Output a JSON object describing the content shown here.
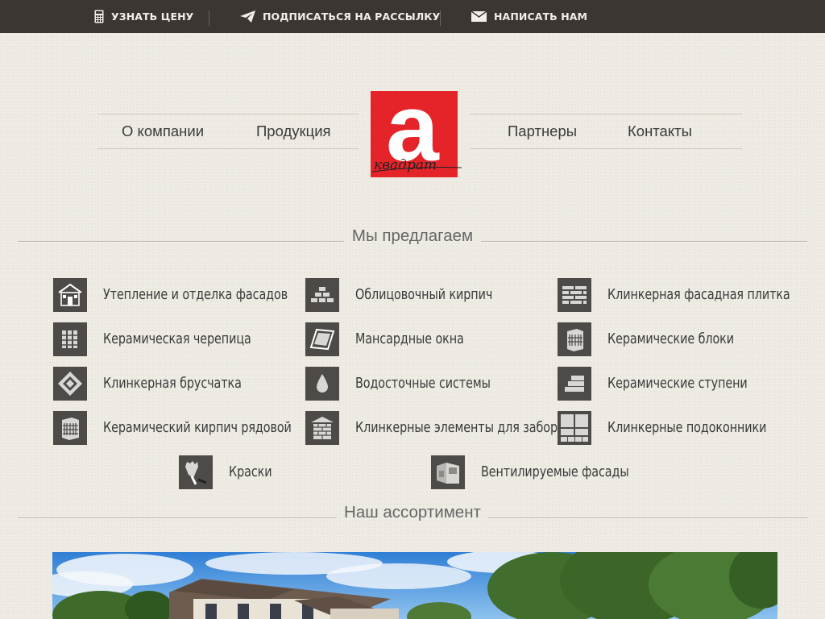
{
  "topbar": {
    "items": [
      {
        "label": "УЗНАТЬ ЦЕНУ",
        "icon": "calculator-icon"
      },
      {
        "label": "ПОДПИСАТЬСЯ НА РАССЫЛКУ",
        "icon": "paper-plane-icon"
      },
      {
        "label": "НАПИСАТЬ НАМ",
        "icon": "envelope-icon"
      }
    ]
  },
  "nav": {
    "items": [
      "О компании",
      "Продукция",
      "Партнеры",
      "Контакты"
    ],
    "logo_letter": "a",
    "logo_script": "квадрат"
  },
  "offer": {
    "title": "Мы предлагаем",
    "items": [
      {
        "label": "Утепление и отделка фасадов",
        "icon": "house-facade-icon"
      },
      {
        "label": "Облицовочный кирпич",
        "icon": "brick-pile-icon"
      },
      {
        "label": "Клинкерная фасадная плитка",
        "icon": "tile-rows-icon"
      },
      {
        "label": "Керамическая черепица",
        "icon": "roof-tiles-icon"
      },
      {
        "label": "Мансардные окна",
        "icon": "roof-window-icon"
      },
      {
        "label": "Керамические блоки",
        "icon": "ceramic-block-icon"
      },
      {
        "label": "Клинкерная брусчатка",
        "icon": "paving-stone-icon"
      },
      {
        "label": "Водосточные системы",
        "icon": "water-drop-icon"
      },
      {
        "label": "Керамические ступени",
        "icon": "steps-icon"
      },
      {
        "label": "Керамический кирпич рядовой",
        "icon": "brick-block-icon"
      },
      {
        "label": "Клинкерные элементы для забора",
        "icon": "fence-element-icon"
      },
      {
        "label": "Клинкерные подоконники",
        "icon": "window-sill-icon"
      },
      {
        "label": "Краски",
        "icon": "paint-brush-icon"
      },
      {
        "label": "Вентилируемые фасады",
        "icon": "ventilated-facade-icon"
      }
    ]
  },
  "assortment": {
    "title": "Наш ассортимент"
  },
  "colors": {
    "topbar_bg": "#3b3631",
    "logo_red": "#e5242a",
    "icon_bg": "#4d4a47",
    "page_bg": "#eeebe3"
  }
}
